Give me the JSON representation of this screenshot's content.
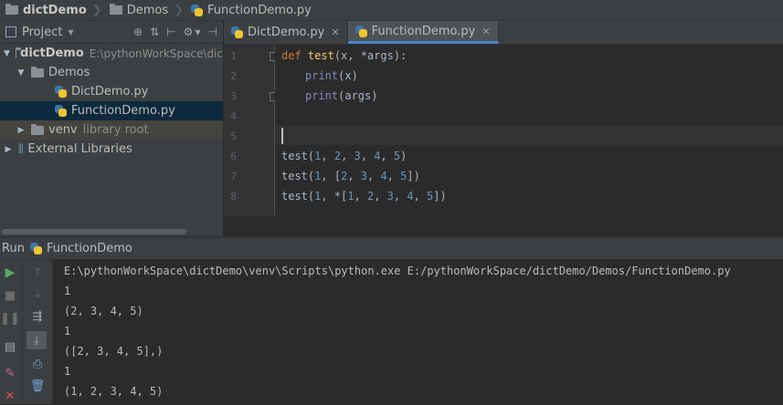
{
  "breadcrumb": {
    "project": "dictDemo",
    "folder": "Demos",
    "file": "FunctionDemo.py"
  },
  "project_panel": {
    "title": "Project",
    "tree": [
      {
        "label": "dictDemo",
        "path": "E:\\pythonWorkSpace\\dic",
        "expanded": true
      },
      {
        "label": "Demos",
        "expanded": true
      },
      {
        "label": "DictDemo.py"
      },
      {
        "label": "FunctionDemo.py",
        "selected": true
      },
      {
        "label": "venv",
        "note": "library root",
        "expanded": false
      },
      {
        "label": "External Libraries",
        "expanded": false
      }
    ]
  },
  "tabs": [
    {
      "label": "DictDemo.py",
      "active": false
    },
    {
      "label": "FunctionDemo.py",
      "active": true
    }
  ],
  "editor": {
    "line_numbers": [
      "1",
      "2",
      "3",
      "4",
      "5",
      "6",
      "7",
      "8"
    ],
    "code": [
      {
        "kw": "def ",
        "fn": "test",
        "rest": "(x, *args):"
      },
      {
        "bi": "print",
        "rest": "(x)"
      },
      {
        "bi": "print",
        "rest": "(args)"
      },
      {},
      {},
      {
        "call": "test",
        "parts": [
          [
            "p",
            "("
          ],
          [
            "n",
            "1"
          ],
          [
            "p",
            ", "
          ],
          [
            "n",
            "2"
          ],
          [
            "p",
            ", "
          ],
          [
            "n",
            "3"
          ],
          [
            "p",
            ", "
          ],
          [
            "n",
            "4"
          ],
          [
            "p",
            ", "
          ],
          [
            "n",
            "5"
          ],
          [
            "p",
            ")"
          ]
        ]
      },
      {
        "call": "test",
        "parts": [
          [
            "p",
            "("
          ],
          [
            "n",
            "1"
          ],
          [
            "p",
            ", ["
          ],
          [
            "n",
            "2"
          ],
          [
            "p",
            ", "
          ],
          [
            "n",
            "3"
          ],
          [
            "p",
            ", "
          ],
          [
            "n",
            "4"
          ],
          [
            "p",
            ", "
          ],
          [
            "n",
            "5"
          ],
          [
            "p",
            "])"
          ]
        ]
      },
      {
        "call": "test",
        "parts": [
          [
            "p",
            "("
          ],
          [
            "n",
            "1"
          ],
          [
            "p",
            ", *["
          ],
          [
            "n",
            "1"
          ],
          [
            "p",
            ", "
          ],
          [
            "n",
            "2"
          ],
          [
            "p",
            ", "
          ],
          [
            "n",
            "3"
          ],
          [
            "p",
            ", "
          ],
          [
            "n",
            "4"
          ],
          [
            "p",
            ", "
          ],
          [
            "n",
            "5"
          ],
          [
            "p",
            "])"
          ]
        ]
      }
    ]
  },
  "run": {
    "label": "Run",
    "config": "FunctionDemo",
    "console": [
      "E:\\pythonWorkSpace\\dictDemo\\venv\\Scripts\\python.exe E:/pythonWorkSpace/dictDemo/Demos/FunctionDemo.py",
      "1",
      "(2, 3, 4, 5)",
      "1",
      "([2, 3, 4, 5],)",
      "1",
      "(1, 2, 3, 4, 5)"
    ]
  },
  "colors": {
    "keyword": "#cc7832",
    "function": "#ffc66d",
    "number": "#6897bb",
    "builtin": "#8888c6",
    "selection": "#0d293e",
    "tab_accent": "#4a88c7"
  }
}
